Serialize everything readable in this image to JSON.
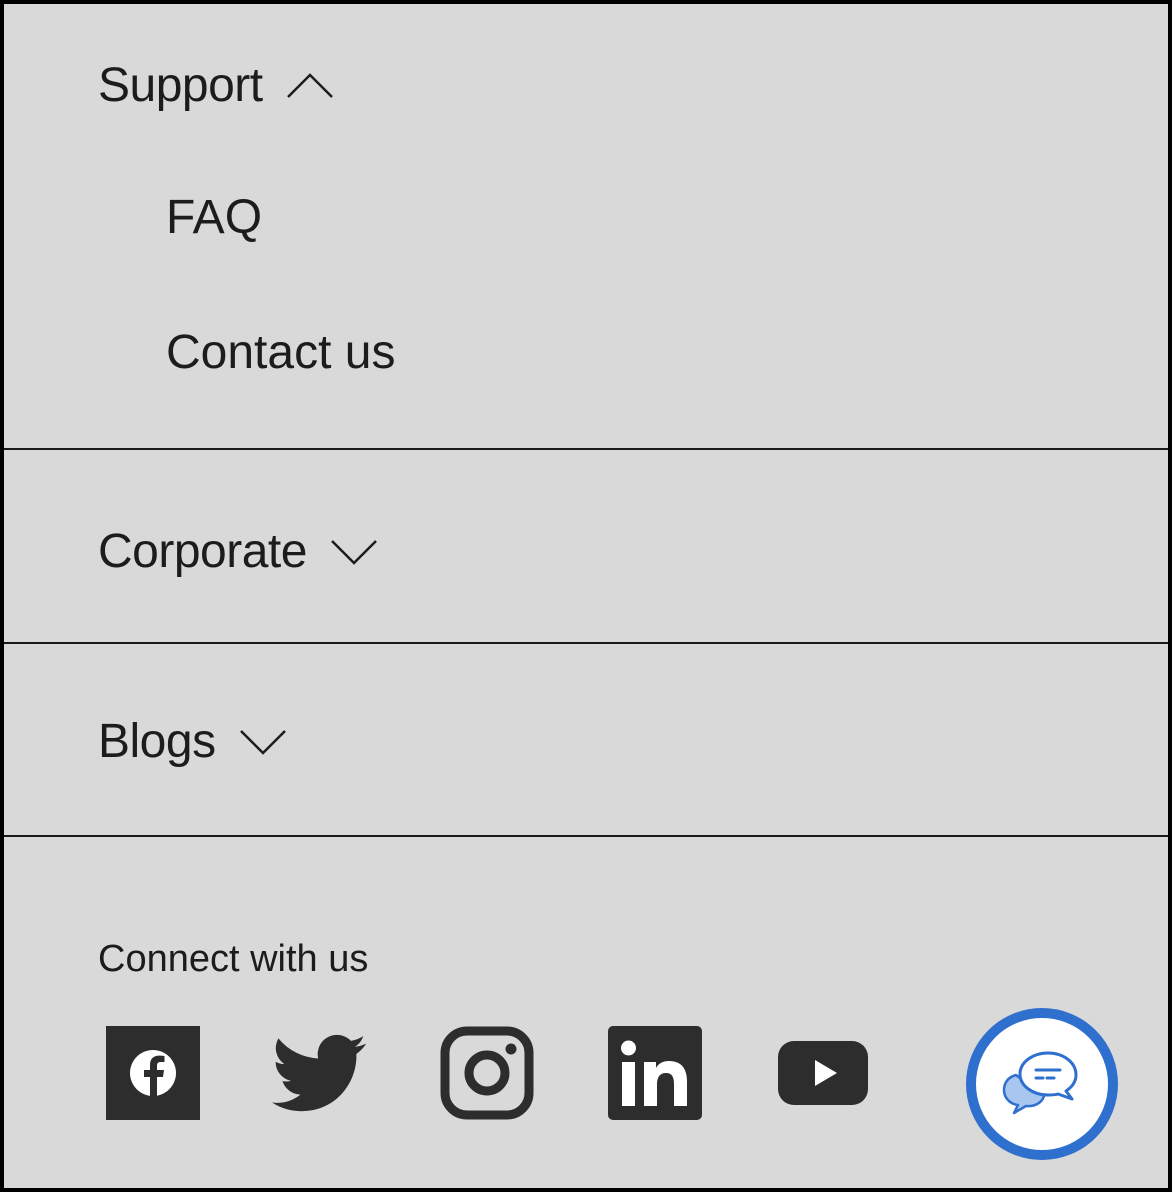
{
  "support": {
    "title": "Support",
    "expanded": true,
    "items": [
      {
        "label": "FAQ"
      },
      {
        "label": "Contact us"
      }
    ]
  },
  "corporate": {
    "title": "Corporate",
    "expanded": false
  },
  "blogs": {
    "title": "Blogs",
    "expanded": false
  },
  "connect": {
    "heading": "Connect with us",
    "icons": [
      "facebook-icon",
      "twitter-icon",
      "instagram-icon",
      "linkedin-icon",
      "youtube-icon"
    ]
  },
  "chat": {
    "icon": "chat-bubbles-icon",
    "accent": "#2f6fce"
  },
  "colors": {
    "background": "#d9d9d9",
    "text": "#1c1c1c",
    "icons": "#2d2d2d"
  }
}
